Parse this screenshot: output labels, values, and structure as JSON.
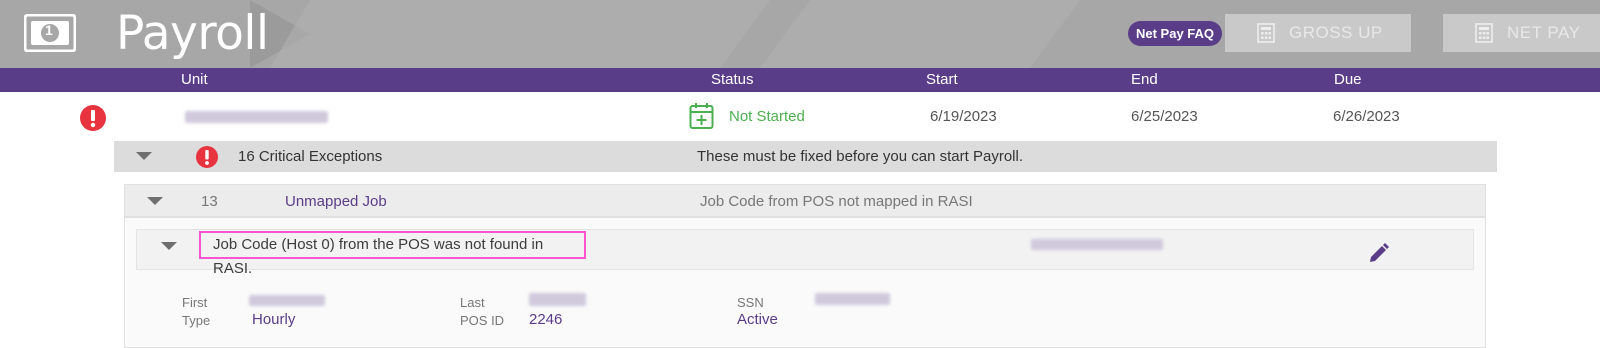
{
  "header": {
    "title": "Payroll",
    "faq_label": "Net Pay FAQ",
    "gross_up_label": "GROSS UP",
    "net_pay_label": "NET PAY",
    "money_glyph": "1"
  },
  "columns": {
    "unit": "Unit",
    "status": "Status",
    "start": "Start",
    "end": "End",
    "due": "Due"
  },
  "unit_row": {
    "status": "Not Started",
    "start": "6/19/2023",
    "end": "6/25/2023",
    "due": "6/26/2023"
  },
  "exceptions": {
    "summary": "16 Critical Exceptions",
    "message": "These must be fixed before you can start Payroll."
  },
  "sub_group": {
    "count": "13",
    "name": "Unmapped Job",
    "description": "Job Code from POS not mapped in RASI"
  },
  "detail": {
    "message": "Job Code (Host 0) from the POS was not found in RASI.",
    "first_label": "First",
    "type_label": "Type",
    "type_value": "Hourly",
    "last_label": "Last",
    "posid_label": "POS ID",
    "posid_value": "2246",
    "ssn_label": "SSN",
    "status_value": "Active"
  },
  "colors": {
    "purple": "#5a3d89",
    "alert_red": "#e8343f",
    "status_green": "#4caf50",
    "highlight_pink": "#ff55d0"
  }
}
